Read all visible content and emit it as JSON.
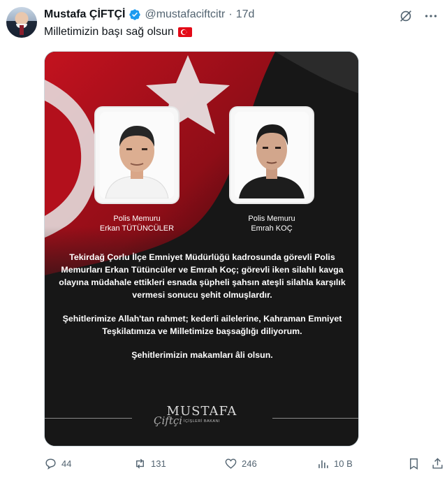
{
  "tweet": {
    "author_name": "Mustafa ÇİFTÇİ",
    "handle": "@mustafaciftcitr",
    "separator": "·",
    "time": "17d",
    "text": "Milletimizin başı sağ olsun",
    "flag_icon": "turkey-flag-emoji"
  },
  "image": {
    "officers": [
      {
        "title": "Polis Memuru",
        "name": "Erkan TÜTÜNCÜLER"
      },
      {
        "title": "Polis Memuru",
        "name": "Emrah KOÇ"
      }
    ],
    "paragraphs": [
      "Tekirdağ Çorlu İlçe Emniyet Müdürlüğü kadrosunda görevli Polis Memurları Erkan Tütüncüler ve Emrah Koç; görevli iken silahlı kavga olayına müdahale ettikleri esnada şüpheli şahsın ateşli silahla karşılık vermesi sonucu şehit olmuşlardır.",
      "Şehitlerimize Allah'tan rahmet; kederli ailelerine, Kahraman Emniyet Teşkilatımıza ve Milletimize başsağlığı diliyorum.",
      "Şehitlerimizin makamları âli olsun."
    ],
    "signature_name": "MUSTAFA",
    "signature_script": "Çiftçi",
    "signature_sub": "İÇİŞLERİ BAKANI"
  },
  "actions": {
    "replies": "44",
    "reposts": "131",
    "likes": "246",
    "views": "10 B"
  },
  "colors": {
    "verified": "#1d9bf0",
    "flag_red": "#e30a17",
    "muted": "#536471"
  }
}
